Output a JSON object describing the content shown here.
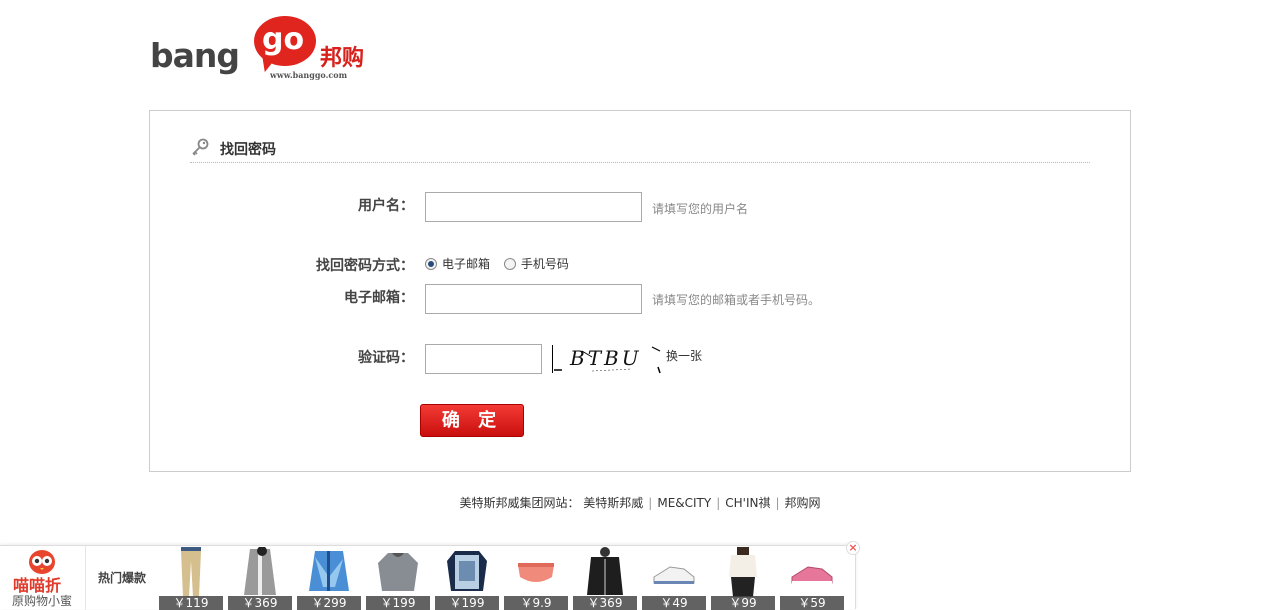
{
  "logo": {
    "text_latin": "bang",
    "text_go": "go",
    "text_cn": "邦购",
    "url": "www.banggo.com",
    "accent": "#e0251f"
  },
  "panel": {
    "title": "找回密码",
    "icon": "key-icon"
  },
  "form": {
    "username_label": "用户名：",
    "username_value": "",
    "username_hint": "请填写您的用户名",
    "method_label": "找回密码方式：",
    "method_options": [
      "电子邮箱",
      "手机号码"
    ],
    "method_selected": "电子邮箱",
    "contact_label": "电子邮箱：",
    "contact_value": "",
    "contact_hint": "请填写您的邮箱或者手机号码。",
    "captcha_label": "验证码：",
    "captcha_value": "",
    "captcha_image_text": "BTBU",
    "refresh_label": "换一张",
    "submit_label": "确 定"
  },
  "footer": {
    "prefix": "美特斯邦威集团网站：",
    "links": [
      "美特斯邦威",
      "ME&CITY",
      "CH'IN祺",
      "邦购网"
    ]
  },
  "bottom_bar": {
    "brand_name": "喵喵折",
    "brand_sub": "原购物小蜜",
    "hot_label": "热门爆款",
    "close": "×",
    "products": [
      {
        "price": "￥119",
        "kind": "khaki-pants"
      },
      {
        "price": "￥369",
        "kind": "gray-cardigan"
      },
      {
        "price": "￥299",
        "kind": "blue-jacket"
      },
      {
        "price": "￥199",
        "kind": "gray-sweater"
      },
      {
        "price": "￥199",
        "kind": "print-tee"
      },
      {
        "price": "￥9.9",
        "kind": "pink-underwear"
      },
      {
        "price": "￥369",
        "kind": "black-jacket"
      },
      {
        "price": "￥49",
        "kind": "white-sneaker"
      },
      {
        "price": "￥99",
        "kind": "white-blouse"
      },
      {
        "price": "￥59",
        "kind": "pink-sneaker"
      }
    ]
  }
}
